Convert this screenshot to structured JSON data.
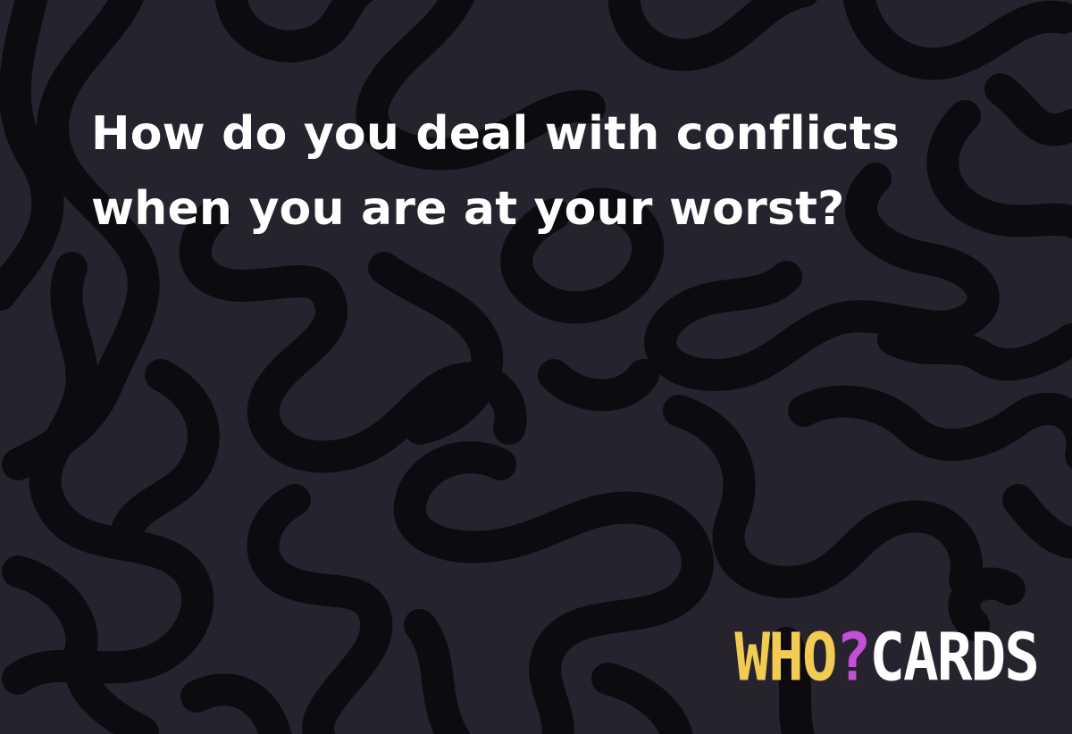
{
  "card": {
    "question_lines": [
      "How do you deal with conflicts",
      "when you are at your worst?"
    ]
  },
  "logo": {
    "part1": "WHO",
    "part2": "?",
    "part3": "CARDS",
    "colors": {
      "part1": "#f2cc52",
      "part2": "#c64fd9",
      "part3": "#ffffff"
    }
  },
  "background": {
    "base_color": "#27232e",
    "pattern_color": "#0d0b10",
    "pattern_name": "squiggle-maze"
  }
}
